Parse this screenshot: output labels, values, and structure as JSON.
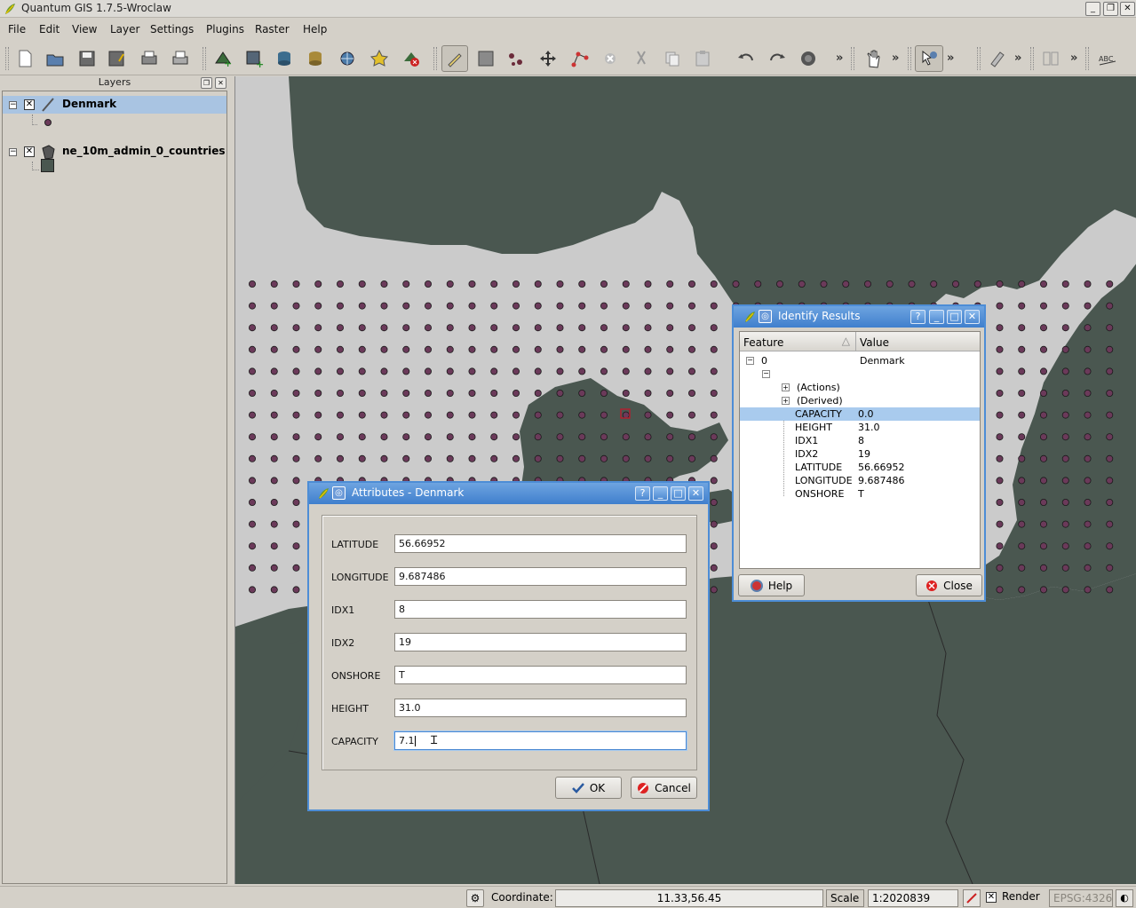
{
  "window": {
    "title": "Quantum GIS 1.7.5-Wroclaw"
  },
  "menu": [
    "File",
    "Edit",
    "View",
    "Layer",
    "Settings",
    "Plugins",
    "Raster",
    "Help"
  ],
  "toolbar": {
    "icons": [
      "new-project-icon",
      "open-project-icon",
      "save-project-icon",
      "save-as-icon",
      "print-composer-icon",
      "print-icon",
      "add-vector-layer-icon",
      "add-raster-layer-icon",
      "add-postgis-layer-icon",
      "add-spatialite-layer-icon",
      "add-wms-layer-icon",
      "new-shapefile-icon",
      "remove-layer-icon",
      "toggle-editing-icon",
      "save-edits-icon",
      "add-feature-icon",
      "move-feature-icon",
      "node-tool-icon",
      "delete-selected-icon",
      "cut-features-icon",
      "copy-features-icon",
      "paste-features-icon",
      "undo-icon",
      "redo-icon",
      "simplify-feature-icon",
      "pan-icon",
      "identify-icon",
      "measure-icon",
      "label-icon",
      "abc-label-icon"
    ]
  },
  "layers": {
    "title": "Layers",
    "items": [
      {
        "name": "Denmark",
        "checked": true,
        "selected": true
      },
      {
        "name": "ne_10m_admin_0_countries",
        "checked": true,
        "selected": false
      }
    ]
  },
  "identify": {
    "title": "Identify Results",
    "col_feature": "Feature",
    "col_value": "Value",
    "root_id": "0",
    "root_value": "Denmark",
    "actions": "(Actions)",
    "derived": "(Derived)",
    "rows": [
      {
        "field": "CAPACITY",
        "value": "0.0",
        "selected": true
      },
      {
        "field": "HEIGHT",
        "value": "31.0"
      },
      {
        "field": "IDX1",
        "value": "8"
      },
      {
        "field": "IDX2",
        "value": "19"
      },
      {
        "field": "LATITUDE",
        "value": "56.66952"
      },
      {
        "field": "LONGITUDE",
        "value": "9.687486"
      },
      {
        "field": "ONSHORE",
        "value": "T"
      }
    ],
    "help_label": "Help",
    "close_label": "Close"
  },
  "attributes": {
    "title": "Attributes - Denmark",
    "fields": [
      {
        "label": "LATITUDE",
        "value": "56.66952"
      },
      {
        "label": "LONGITUDE",
        "value": "9.687486"
      },
      {
        "label": "IDX1",
        "value": "8"
      },
      {
        "label": "IDX2",
        "value": "19"
      },
      {
        "label": "ONSHORE",
        "value": "T"
      },
      {
        "label": "HEIGHT",
        "value": "31.0"
      },
      {
        "label": "CAPACITY",
        "value": "7.1",
        "focused": true
      }
    ],
    "ok_label": "OK",
    "cancel_label": "Cancel"
  },
  "status": {
    "coordinate_label": "Coordinate:",
    "coordinate_value": "11.33,56.45",
    "scale_label": "Scale",
    "scale_value": "1:2020839",
    "render_label": "Render",
    "crs": "EPSG:4326"
  },
  "colors": {
    "land": "#4a5750",
    "sea": "#cbcbcb",
    "point": "#6b3a5a",
    "selection": "#a9cbee",
    "title_blue": "#4a88d2"
  }
}
